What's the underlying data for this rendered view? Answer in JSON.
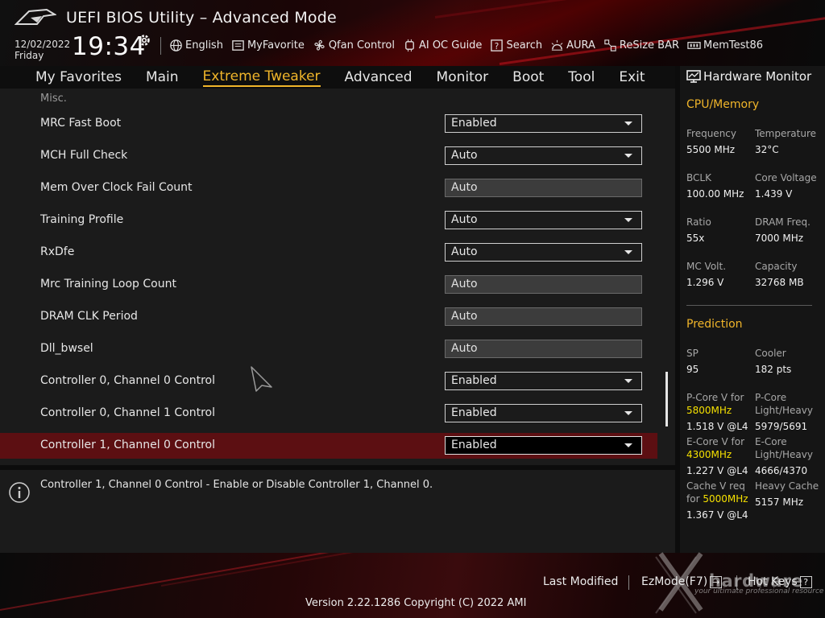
{
  "header": {
    "title": "UEFI BIOS Utility – Advanced Mode",
    "date": "12/02/2022",
    "weekday": "Friday",
    "time": "19:34",
    "toolbar": [
      {
        "label": "English",
        "icon": "globe-icon"
      },
      {
        "label": "MyFavorite",
        "icon": "favorite-list-icon"
      },
      {
        "label": "Qfan Control",
        "icon": "fan-icon"
      },
      {
        "label": "AI OC Guide",
        "icon": "ai-chip-icon"
      },
      {
        "label": "Search",
        "icon": "question-box-icon"
      },
      {
        "label": "AURA",
        "icon": "aura-light-icon"
      },
      {
        "label": "ReSize BAR",
        "icon": "resize-bar-icon"
      },
      {
        "label": "MemTest86",
        "icon": "memory-module-icon"
      }
    ]
  },
  "menu": {
    "items": [
      "My Favorites",
      "Main",
      "Extreme Tweaker",
      "Advanced",
      "Monitor",
      "Boot",
      "Tool",
      "Exit"
    ],
    "active": "Extreme Tweaker"
  },
  "main": {
    "section": "Misc.",
    "rows": [
      {
        "label": "MRC Fast Boot",
        "value": "Enabled",
        "dropdown": true
      },
      {
        "label": "MCH Full Check",
        "value": "Auto",
        "dropdown": true
      },
      {
        "label": "Mem Over Clock Fail Count",
        "value": "Auto",
        "dropdown": false
      },
      {
        "label": "Training Profile",
        "value": "Auto",
        "dropdown": true
      },
      {
        "label": "RxDfe",
        "value": "Auto",
        "dropdown": true
      },
      {
        "label": "Mrc Training Loop Count",
        "value": "Auto",
        "dropdown": false
      },
      {
        "label": "DRAM CLK Period",
        "value": "Auto",
        "dropdown": false
      },
      {
        "label": "Dll_bwsel",
        "value": "Auto",
        "dropdown": false
      },
      {
        "label": "Controller 0, Channel 0 Control",
        "value": "Enabled",
        "dropdown": true
      },
      {
        "label": "Controller 0, Channel 1 Control",
        "value": "Enabled",
        "dropdown": true
      },
      {
        "label": "Controller 1, Channel 0 Control",
        "value": "Enabled",
        "dropdown": true,
        "selected": true
      }
    ]
  },
  "help": {
    "text": "Controller 1, Channel 0 Control - Enable or Disable Controller 1, Channel 0."
  },
  "hwmon": {
    "title": "Hardware Monitor",
    "cpu_section": "CPU/Memory",
    "frequency_label": "Frequency",
    "frequency_value": "5500 MHz",
    "temperature_label": "Temperature",
    "temperature_value": "32°C",
    "bclk_label": "BCLK",
    "bclk_value": "100.00 MHz",
    "core_voltage_label": "Core Voltage",
    "core_voltage_value": "1.439 V",
    "ratio_label": "Ratio",
    "ratio_value": "55x",
    "dram_freq_label": "DRAM Freq.",
    "dram_freq_value": "7000 MHz",
    "mc_volt_label": "MC Volt.",
    "mc_volt_value": "1.296 V",
    "capacity_label": "Capacity",
    "capacity_value": "32768 MB",
    "prediction_section": "Prediction",
    "sp_label": "SP",
    "sp_value": "95",
    "cooler_label": "Cooler",
    "cooler_value": "182 pts",
    "pcore_v_label": "P-Core V for",
    "pcore_v_freq": "5800MHz",
    "pcore_v_value": "1.518 V @L4",
    "pcore_lh_label1": "P-Core",
    "pcore_lh_label2": "Light/Heavy",
    "pcore_lh_value": "5979/5691",
    "ecore_v_label": "E-Core V for",
    "ecore_v_freq": "4300MHz",
    "ecore_v_value": "1.227 V @L4",
    "ecore_lh_label1": "E-Core",
    "ecore_lh_label2": "Light/Heavy",
    "ecore_lh_value": "4666/4370",
    "cache_v_label1": "Cache V req",
    "cache_v_label2": "for",
    "cache_v_freq": "5000MHz",
    "cache_v_value": "1.367 V @L4",
    "heavy_cache_label": "Heavy Cache",
    "heavy_cache_value": "5157 MHz"
  },
  "footer": {
    "last_modified": "Last Modified",
    "ezmode": "EzMode(F7)",
    "ezmode_key": "→",
    "hotkeys": "Hot Keys",
    "hotkeys_key": "?",
    "version": "Version 2.22.1286 Copyright (C) 2022 AMI"
  },
  "watermark": {
    "text": "hardware",
    "subtitle": "your ultimate professional resource"
  },
  "colors": {
    "accent": "#f0b52a",
    "selected_row": "#5c0f12",
    "highlight_value": "#f5e000"
  }
}
